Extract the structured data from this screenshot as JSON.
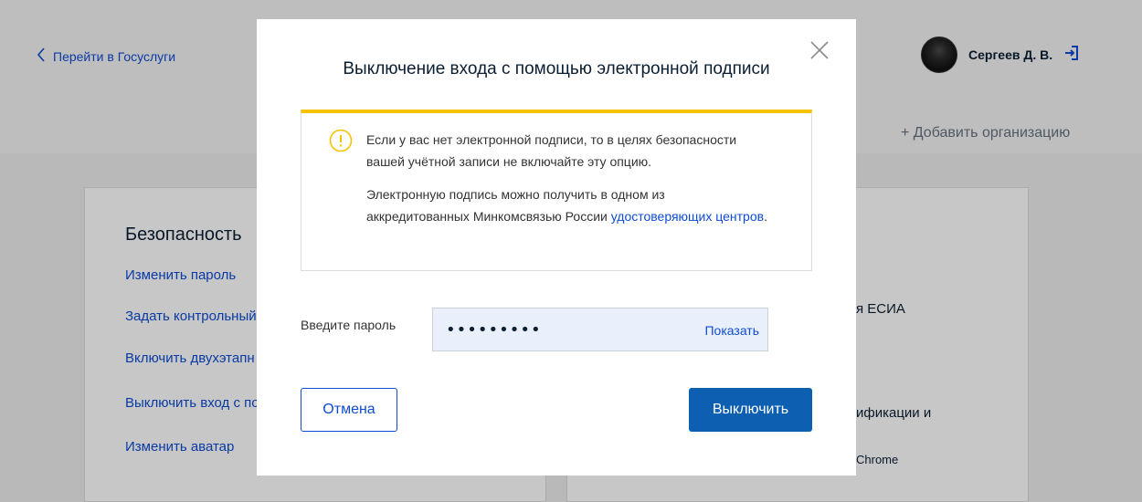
{
  "header": {
    "back_link": "Перейти в Госуслуги",
    "user_name": "Сергеев Д. В.",
    "add_org": "+ Добавить организацию"
  },
  "security": {
    "title": "Безопасность",
    "links": [
      "Изменить пароль",
      "Задать контрольный",
      "Включить двухэтапн",
      "Выключить вход с по",
      "Изменить аватар"
    ]
  },
  "right_panel": {
    "texts": [
      "я ЕСИА",
      "ификации и",
      "Chrome"
    ]
  },
  "modal": {
    "title": "Выключение входа с помощью электронной подписи",
    "warning": {
      "p1": "Если у вас нет электронной подписи, то в целях безопасности вашей учётной записи не включайте эту опцию.",
      "p2_text": "Электронную подпись можно получить в одном из аккредитованных Минкомсвязью России ",
      "p2_link": "удостоверяющих центров",
      "p2_end": "."
    },
    "password": {
      "label": "Введите пароль",
      "value": "•••••••••",
      "show_label": "Показать"
    },
    "cancel_label": "Отмена",
    "disable_label": "Выключить"
  },
  "colors": {
    "accent": "#0d4cd3",
    "primary_button": "#0d5fb2",
    "warning": "#f5c200"
  },
  "icons": [
    "chevron-left-icon",
    "logout-icon",
    "close-icon",
    "warning-icon"
  ]
}
